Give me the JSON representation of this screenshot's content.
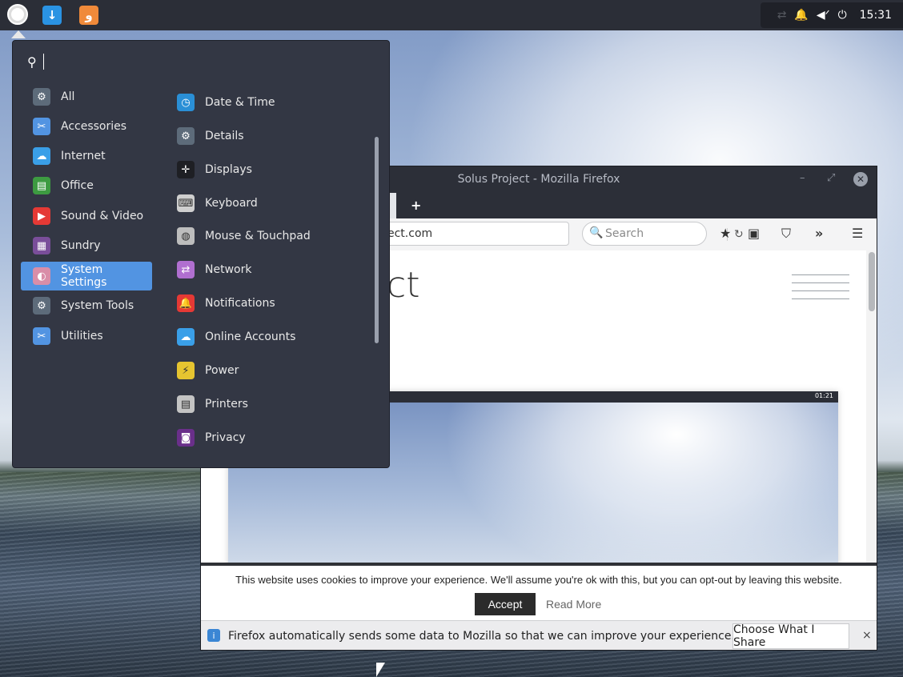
{
  "panel": {
    "launcher_icon": "solus-menu-icon",
    "pinned": [
      {
        "name": "download-icon",
        "glyph": "↓",
        "color": "#2a93e3"
      },
      {
        "name": "firefox-icon",
        "glyph": "ﻭ",
        "color": "#f08a3a"
      }
    ],
    "tray": {
      "network_icon": "⇄",
      "bell_icon": "🔔",
      "mute_icon": "◀ᐟ",
      "power_icon": "⏻",
      "clock": "15:31"
    }
  },
  "menu": {
    "search_icon": "⚲",
    "categories": [
      {
        "label": "All",
        "icon": "gear-icon",
        "glyph": "⚙",
        "color": "#5d6b7a"
      },
      {
        "label": "Accessories",
        "icon": "scissors-icon",
        "glyph": "✂",
        "color": "#5294e2"
      },
      {
        "label": "Internet",
        "icon": "cloud-icon",
        "glyph": "☁",
        "color": "#3a9fe8"
      },
      {
        "label": "Office",
        "icon": "document-icon",
        "glyph": "▤",
        "color": "#3d9b41"
      },
      {
        "label": "Sound & Video",
        "icon": "play-icon",
        "glyph": "▶",
        "color": "#e53935"
      },
      {
        "label": "Sundry",
        "icon": "grid-icon",
        "glyph": "▦",
        "color": "#7a4e9a"
      },
      {
        "label": "System Settings",
        "icon": "toggles-icon",
        "glyph": "◐",
        "color": "#d98ea8"
      },
      {
        "label": "System Tools",
        "icon": "gear-icon",
        "glyph": "⚙",
        "color": "#5d6b7a"
      },
      {
        "label": "Utilities",
        "icon": "scissors-icon",
        "glyph": "✂",
        "color": "#5294e2"
      }
    ],
    "active_category": "System Settings",
    "apps": [
      {
        "label": "Date & Time",
        "icon": "clock-icon",
        "glyph": "◷",
        "color": "#2a8fd6"
      },
      {
        "label": "Details",
        "icon": "gear-icon",
        "glyph": "⚙",
        "color": "#5d6b7a"
      },
      {
        "label": "Displays",
        "icon": "displays-icon",
        "glyph": "✛",
        "color": "#1e1f24"
      },
      {
        "label": "Keyboard",
        "icon": "keyboard-icon",
        "glyph": "⌨",
        "color": "#cfcfcf"
      },
      {
        "label": "Mouse & Touchpad",
        "icon": "mouse-icon",
        "glyph": "◍",
        "color": "#bdbdbd"
      },
      {
        "label": "Network",
        "icon": "network-icon",
        "glyph": "⇄",
        "color": "#b06fd0"
      },
      {
        "label": "Notifications",
        "icon": "bell-icon",
        "glyph": "🔔",
        "color": "#e53935"
      },
      {
        "label": "Online Accounts",
        "icon": "cloud-icon",
        "glyph": "☁",
        "color": "#3a9fe8"
      },
      {
        "label": "Power",
        "icon": "power-icon",
        "glyph": "⚡",
        "color": "#e6c430"
      },
      {
        "label": "Printers",
        "icon": "printer-icon",
        "glyph": "▤",
        "color": "#c4c4c4"
      },
      {
        "label": "Privacy",
        "icon": "mask-icon",
        "glyph": "◙",
        "color": "#6a2f8a"
      }
    ]
  },
  "firefox": {
    "title": "Solus Project - Mozilla Firefox",
    "minimize": "–",
    "maximize": "⤢",
    "close": "✕",
    "new_tab": "+",
    "url_visible": "ect.com",
    "reload_icon": "↻",
    "search_placeholder": "Search",
    "search_icon": "🔍",
    "toolbar_icons": [
      "★",
      "▣",
      "⛉",
      "»",
      "☰"
    ],
    "page_heading_fragment": "ct",
    "screenshot_clock": "01:21",
    "cookie": {
      "message": "This website uses cookies to improve your experience. We'll assume you're ok with this, but you can opt-out by leaving this website.",
      "accept": "Accept",
      "read_more": "Read More"
    },
    "notification": {
      "icon": "i",
      "message": "Firefox automatically sends some data to Mozilla so that we can improve your experience.",
      "button": "Choose What I Share",
      "close": "×"
    }
  },
  "colors": {
    "menu_bg": "#333744",
    "accent": "#5294e2",
    "panel_bg": "#2b2e37"
  }
}
